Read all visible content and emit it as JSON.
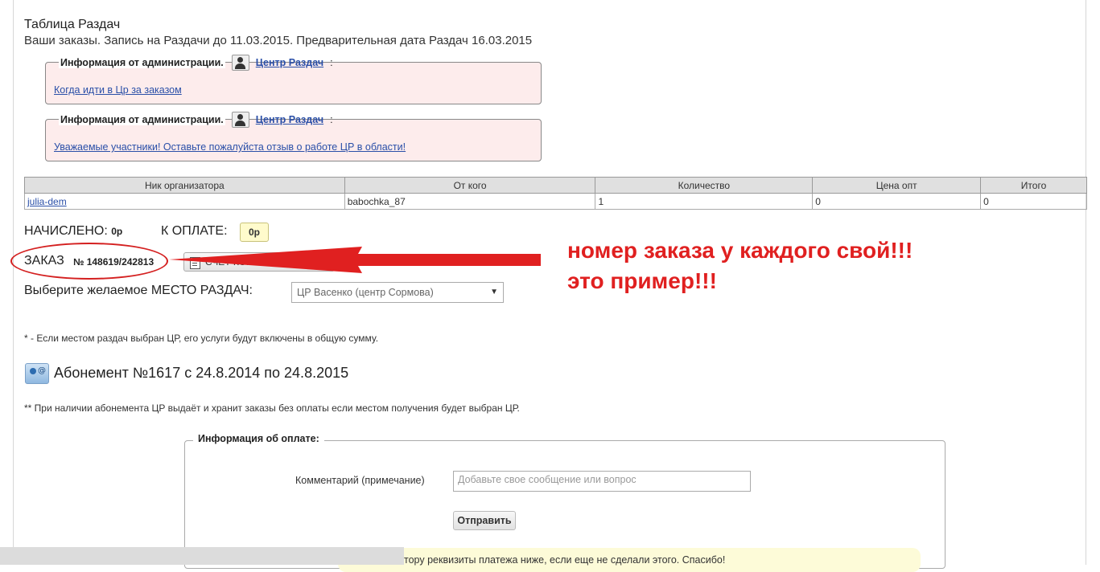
{
  "header": {
    "title": "Таблица Раздач",
    "subtitle": "Ваши заказы. Запись на Раздачи до 11.03.2015. Предварительная дата Раздач 16.03.2015"
  },
  "admin_boxes": [
    {
      "legend": "Информация от администрации.",
      "author": "Центр Раздач",
      "separator": ":",
      "link": "Когда идти в Цр за заказом"
    },
    {
      "legend": "Информация от администрации.",
      "author": "Центр Раздач",
      "separator": ":",
      "link": "Уважаемые участники! Оставьте пожалуйста отзыв о работе ЦР в области!"
    }
  ],
  "table": {
    "headers": [
      "Ник организатора",
      "От кого",
      "Количество",
      "Цена опт",
      "Итого"
    ],
    "rows": [
      [
        "julia-dem",
        "babochka_87",
        "1",
        "0",
        "0"
      ]
    ]
  },
  "summary": {
    "charged_label": "НАЧИСЛЕНО:",
    "charged_value": "0р",
    "topay_label": "К ОПЛАТЕ:",
    "topay_value": "0р"
  },
  "order": {
    "label": "ЗАКАЗ",
    "number": "№ 148619/242813",
    "commissioner_button": "СЧЕТ КОМИССИОНЕРА"
  },
  "annotation": {
    "line1": "номер заказа у каждого свой!!!",
    "line2": "это пример!!!",
    "color": "#e02020"
  },
  "place": {
    "label": "Выберите желаемое МЕСТО РАЗДАЧ:",
    "selected": "ЦР Васенко (центр Сормова)"
  },
  "notes": {
    "note1": "* - Если местом раздач выбран ЦР, его услуги будут включены в общую сумму.",
    "subscription": "Абонемент №1617 с 24.8.2014 по 24.8.2015",
    "note2": "** При наличии абонемента ЦР выдаёт и хранит заказы без оплаты если местом получения будет выбран ЦР."
  },
  "payment": {
    "legend": "Информация об оплате:",
    "comment_label": "Комментарий (примечание)",
    "comment_placeholder": "Добавьте свое сообщение или вопрос",
    "send_button": "Отправить",
    "notice": "тору реквизиты платежа ниже, если еще не сделали этого. Спасибо!"
  }
}
